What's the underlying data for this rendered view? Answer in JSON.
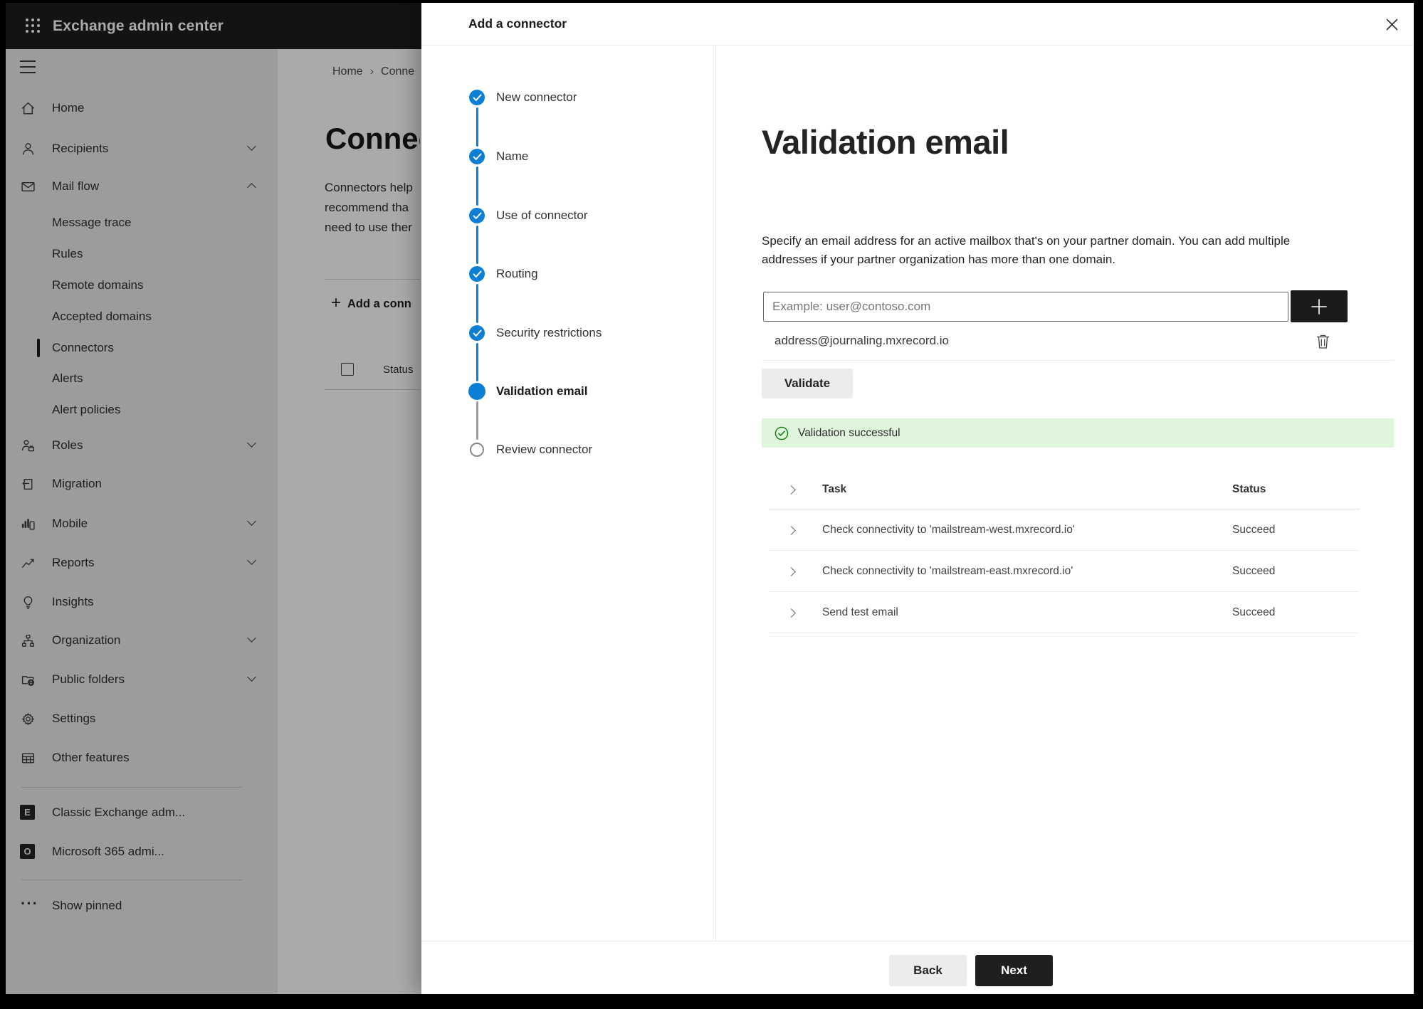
{
  "app": {
    "title": "Exchange admin center"
  },
  "sidebar": {
    "items": [
      {
        "label": "Home",
        "icon": "home-icon",
        "chevron": "none",
        "indent": false,
        "selected": false
      },
      {
        "label": "Recipients",
        "icon": "person-icon",
        "chevron": "down",
        "indent": false,
        "selected": false
      },
      {
        "label": "Mail flow",
        "icon": "mail-icon",
        "chevron": "up",
        "indent": false,
        "selected": false
      },
      {
        "label": "Message trace",
        "icon": "",
        "chevron": "none",
        "indent": true,
        "selected": false
      },
      {
        "label": "Rules",
        "icon": "",
        "chevron": "none",
        "indent": true,
        "selected": false
      },
      {
        "label": "Remote domains",
        "icon": "",
        "chevron": "none",
        "indent": true,
        "selected": false
      },
      {
        "label": "Accepted domains",
        "icon": "",
        "chevron": "none",
        "indent": true,
        "selected": false
      },
      {
        "label": "Connectors",
        "icon": "",
        "chevron": "none",
        "indent": true,
        "selected": true
      },
      {
        "label": "Alerts",
        "icon": "",
        "chevron": "none",
        "indent": true,
        "selected": false
      },
      {
        "label": "Alert policies",
        "icon": "",
        "chevron": "none",
        "indent": true,
        "selected": false
      },
      {
        "label": "Roles",
        "icon": "roles-icon",
        "chevron": "down",
        "indent": false,
        "selected": false
      },
      {
        "label": "Migration",
        "icon": "migration-icon",
        "chevron": "none",
        "indent": false,
        "selected": false
      },
      {
        "label": "Mobile",
        "icon": "mobile-icon",
        "chevron": "down",
        "indent": false,
        "selected": false
      },
      {
        "label": "Reports",
        "icon": "reports-icon",
        "chevron": "down",
        "indent": false,
        "selected": false
      },
      {
        "label": "Insights",
        "icon": "lightbulb-icon",
        "chevron": "none",
        "indent": false,
        "selected": false
      },
      {
        "label": "Organization",
        "icon": "org-chart-icon",
        "chevron": "down",
        "indent": false,
        "selected": false
      },
      {
        "label": "Public folders",
        "icon": "folder-globe-icon",
        "chevron": "down",
        "indent": false,
        "selected": false
      },
      {
        "label": "Settings",
        "icon": "gear-icon",
        "chevron": "none",
        "indent": false,
        "selected": false
      },
      {
        "label": "Other features",
        "icon": "grid-table-icon",
        "chevron": "none",
        "indent": false,
        "selected": false
      },
      {
        "label": "Classic Exchange adm...",
        "icon": "exchange-logo-icon",
        "chevron": "none",
        "indent": false,
        "selected": false
      },
      {
        "label": "Microsoft 365 admi...",
        "icon": "microsoft-365-icon",
        "chevron": "none",
        "indent": false,
        "selected": false
      },
      {
        "label": "Show pinned",
        "icon": "ellipsis-icon",
        "chevron": "none",
        "indent": false,
        "selected": false
      }
    ],
    "exchange_logo_letter": "E",
    "m365_logo_letter": "O",
    "ellipsis_glyph": "···"
  },
  "background": {
    "breadcrumb": {
      "home": "Home",
      "separator": "›",
      "current": "Conne"
    },
    "page_title": "Connect",
    "paragraph_lines": [
      "Connectors help",
      "recommend tha",
      "need to use ther"
    ],
    "add_button_plus": "+",
    "add_button_label": "Add a conn",
    "column_header": "Status"
  },
  "dialog": {
    "title": "Add a connector",
    "steps": [
      {
        "label": "New connector",
        "state": "complete"
      },
      {
        "label": "Name",
        "state": "complete"
      },
      {
        "label": "Use of connector",
        "state": "complete"
      },
      {
        "label": "Routing",
        "state": "complete"
      },
      {
        "label": "Security restrictions",
        "state": "complete"
      },
      {
        "label": "Validation email",
        "state": "current"
      },
      {
        "label": "Review connector",
        "state": "upcoming"
      }
    ],
    "content": {
      "heading": "Validation email",
      "description": "Specify an email address for an active mailbox that's on your partner domain. You can add multiple addresses if your partner organization has more than one domain.",
      "email_placeholder": "Example: user@contoso.com",
      "addresses": [
        "address@journaling.mxrecord.io"
      ],
      "validate_label": "Validate",
      "banner_text": "Validation successful",
      "table": {
        "headers": {
          "task": "Task",
          "status": "Status"
        },
        "rows": [
          {
            "task": "Check connectivity to 'mailstream-west.mxrecord.io'",
            "status": "Succeed"
          },
          {
            "task": "Check connectivity to 'mailstream-east.mxrecord.io'",
            "status": "Succeed"
          },
          {
            "task": "Send test email",
            "status": "Succeed"
          }
        ]
      }
    },
    "footer": {
      "back_label": "Back",
      "next_label": "Next"
    }
  },
  "colors": {
    "accent_blue": "#0b7fd6",
    "success_banner_bg": "#dff6dd",
    "success_green": "#107c10",
    "topbar_bg": "#1d1d1d",
    "primary_button_bg": "#1f1f1f"
  }
}
